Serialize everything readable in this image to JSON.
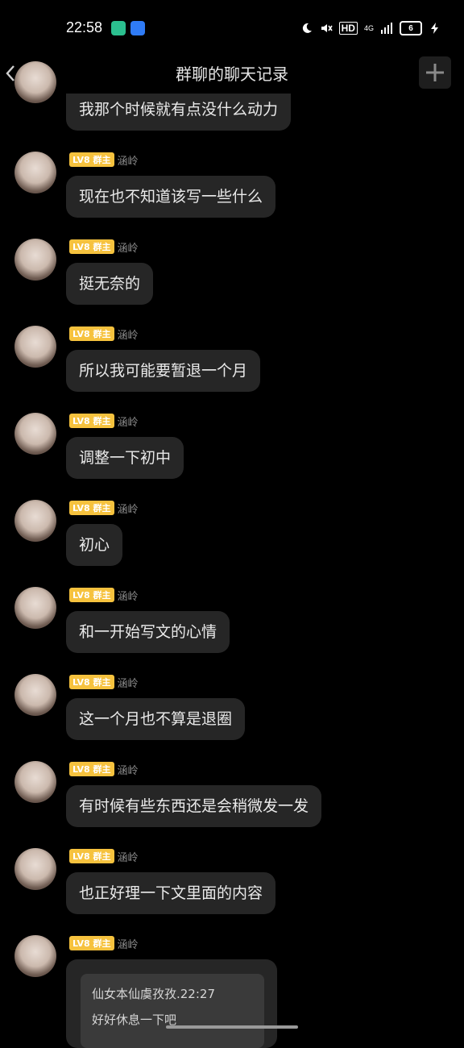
{
  "status": {
    "time": "22:58",
    "battery": "6",
    "net": "4G",
    "hd": "HD"
  },
  "header": {
    "back": "返回",
    "title": "群聊的聊天记录"
  },
  "sender": {
    "badge": "LV8 群主",
    "name": "涵岭"
  },
  "messages": [
    "我那个时候就有点没什么动力",
    "现在也不知道该写一些什么",
    "挺无奈的",
    "所以我可能要暂退一个月",
    "调整一下初中",
    "初心",
    "和一开始写文的心情",
    "这一个月也不算是退圈",
    "有时候有些东西还是会稍微发一发",
    "也正好理一下文里面的内容"
  ],
  "quote": {
    "line1": "仙女本仙虞孜孜.22:27",
    "line2": "好好休息一下吧"
  }
}
